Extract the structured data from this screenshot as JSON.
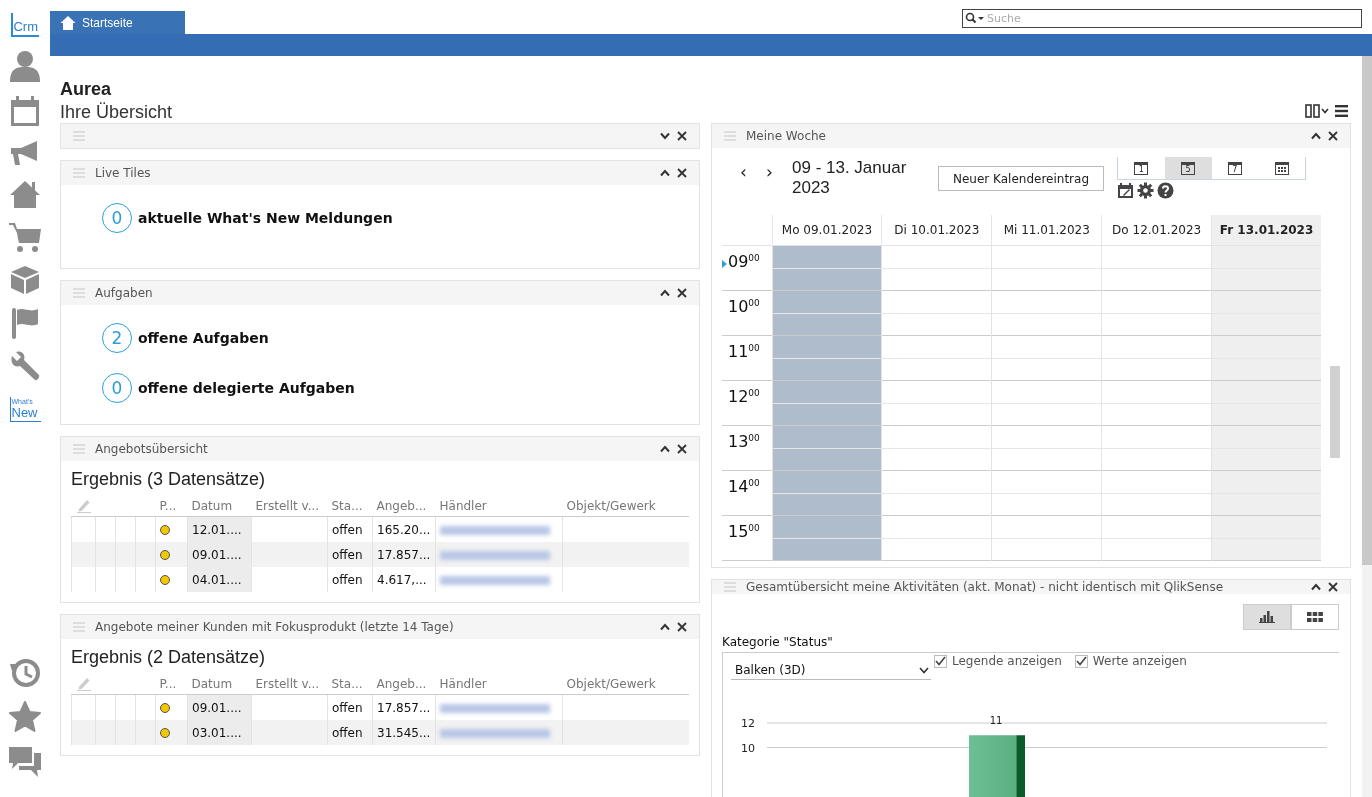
{
  "sidebar": {
    "logo": "Crm",
    "whats_new": {
      "top": "What's",
      "bottom": "New"
    }
  },
  "tabs": [
    {
      "label": "Startseite",
      "selected": true
    }
  ],
  "search": {
    "placeholder": "Suche"
  },
  "page": {
    "title": "Aurea",
    "subtitle": "Ihre Übersicht"
  },
  "left_panels": [
    {
      "kind": "empty",
      "expanded": false
    },
    {
      "kind": "tiles",
      "title": "Live Tiles",
      "expanded": true,
      "tiles": [
        {
          "count": "0",
          "label": "aktuelle What's New Meldungen"
        }
      ]
    },
    {
      "kind": "tiles",
      "title": "Aufgaben",
      "expanded": true,
      "tiles": [
        {
          "count": "2",
          "label": "offene Aufgaben"
        },
        {
          "count": "0",
          "label": "offene delegierte Aufgaben"
        }
      ]
    },
    {
      "kind": "table",
      "title": "Angebotsübersicht",
      "expanded": true,
      "result": "Ergebnis (3 Datensätze)",
      "columns": [
        "P...",
        "Datum",
        "Erstellt v...",
        "Sta...",
        "Angeb...",
        "Händler",
        "Objekt/Gewerk"
      ],
      "rows": [
        {
          "date": "12.01....",
          "status": "offen",
          "amount": "165.20..."
        },
        {
          "date": "09.01....",
          "status": "offen",
          "amount": "17.857..."
        },
        {
          "date": "04.01....",
          "status": "offen",
          "amount": "4.617,..."
        }
      ]
    },
    {
      "kind": "table",
      "title": "Angebote meiner Kunden mit Fokusprodukt (letzte 14 Tage)",
      "expanded": true,
      "result": "Ergebnis (2 Datensätze)",
      "columns": [
        "P...",
        "Datum",
        "Erstellt v...",
        "Sta...",
        "Angeb...",
        "Händler",
        "Objekt/Gewerk"
      ],
      "rows": [
        {
          "date": "09.01....",
          "status": "offen",
          "amount": "17.857..."
        },
        {
          "date": "03.01....",
          "status": "offen",
          "amount": "31.545..."
        }
      ]
    }
  ],
  "calendar": {
    "title": "Meine Woche",
    "expanded": true,
    "prev": "‹",
    "next": "›",
    "range": "09 - 13. Januar 2023",
    "new_button": "Neuer Kalendereintrag",
    "views": [
      {
        "kind": "day",
        "label": "1",
        "selected": false
      },
      {
        "kind": "week",
        "label": "5",
        "selected": true
      },
      {
        "kind": "week",
        "label": "7",
        "selected": false
      },
      {
        "kind": "month",
        "selected": false
      }
    ],
    "days": [
      {
        "label": "Mo 09.01.2023",
        "today": false,
        "highlighted": true
      },
      {
        "label": "Di 10.01.2023",
        "today": false,
        "highlighted": false
      },
      {
        "label": "Mi 11.01.2023",
        "today": false,
        "highlighted": false
      },
      {
        "label": "Do 12.01.2023",
        "today": false,
        "highlighted": false
      },
      {
        "label": "Fr 13.01.2023",
        "today": true,
        "highlighted": false
      }
    ],
    "hours": [
      "09$^{00}$",
      "10$^{00}$",
      "11$^{00}$",
      "12$^{00}$",
      "13$^{00}$",
      "14$^{00}$",
      "15$^{00}$"
    ]
  },
  "activities": {
    "title": "Gesamtübersicht meine Aktivitäten (akt. Monat) - nicht identisch mit QlikSense",
    "expanded": true,
    "views": [
      {
        "kind": "chart",
        "selected": true
      },
      {
        "kind": "grid",
        "selected": false
      }
    ],
    "category": "Kategorie \"Status\"",
    "chart_type": "Balken (3D)",
    "options": [
      {
        "label": "Legende anzeigen",
        "checked": true
      },
      {
        "label": "Werte anzeigen",
        "checked": true
      }
    ],
    "chart_data": {
      "type": "bar",
      "values": [
        11
      ],
      "yticks": [
        10,
        12
      ],
      "ylim": [
        0,
        12
      ],
      "data_labels": true
    }
  }
}
